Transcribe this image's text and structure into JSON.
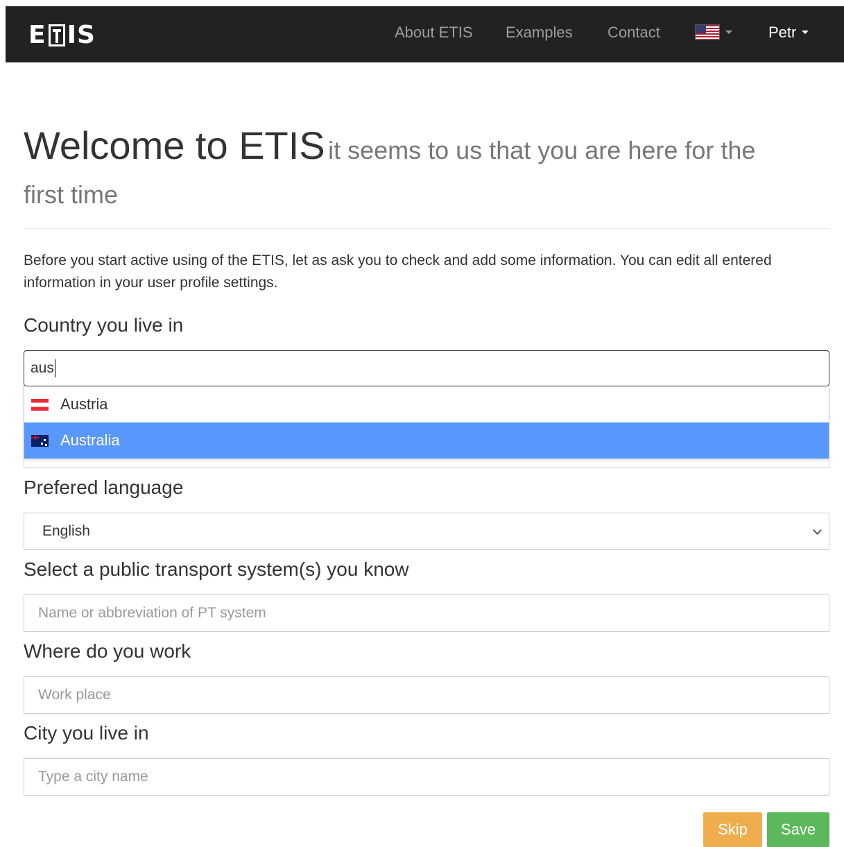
{
  "navbar": {
    "logo_text": "ETIS",
    "items": [
      {
        "label": "About ETIS"
      },
      {
        "label": "Examples"
      },
      {
        "label": "Contact"
      }
    ],
    "language_flag": "us-flag-icon",
    "user_label": "Petr"
  },
  "header": {
    "title": "Welcome to ETIS",
    "subtitle_line1": "it seems to us that you are here for the",
    "subtitle_line2": "first time"
  },
  "intro_text": "Before you start active using of the ETIS, let as ask you to check and add some information. You can edit all entered information in your user profile settings.",
  "form": {
    "country": {
      "label": "Country you live in",
      "value": "aus",
      "suggestions": [
        {
          "label": "Austria",
          "flag": "austria-flag-icon",
          "active": false
        },
        {
          "label": "Australia",
          "flag": "australia-flag-icon",
          "active": true
        }
      ]
    },
    "language": {
      "label": "Prefered language",
      "selected": "English"
    },
    "pt_system": {
      "label": "Select a public transport system(s) you know",
      "placeholder": "Name or abbreviation of PT system"
    },
    "work": {
      "label": "Where do you work",
      "placeholder": "Work place"
    },
    "city": {
      "label": "City you live in",
      "placeholder": "Type a city name"
    }
  },
  "buttons": {
    "skip": "Skip",
    "save": "Save"
  },
  "colors": {
    "navbar_bg": "#222222",
    "highlight": "#5897fb",
    "skip": "#f0ad4e",
    "save": "#5cb85c"
  }
}
